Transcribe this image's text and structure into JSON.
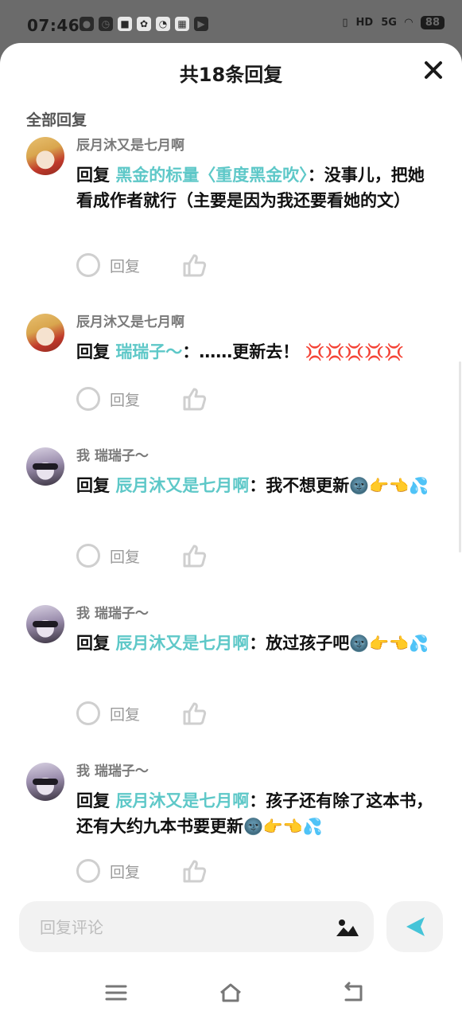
{
  "status_bar": {
    "time": "07:46",
    "left_icons": [
      "wechat-icon",
      "compass-icon",
      "app-icon",
      "baidu-icon",
      "qq-browser-icon",
      "game-icon",
      "media-icon"
    ],
    "right_icons": [
      "vibrate-icon",
      "hd-icon",
      "signal-5g-icon",
      "wifi-icon"
    ],
    "network": "5G",
    "hd": "HD",
    "battery": "88"
  },
  "sheet": {
    "title": "共18条回复",
    "section_label": "全部回复"
  },
  "comments": [
    {
      "user": "辰月沐又是七月啊",
      "reply_prefix": "回复",
      "mention": "黑金的标量〈重度黑金吹〉",
      "text": "：没事儿，把她看成作者就行（主要是因为我还要看她的文）",
      "avatar": "avatar-girl-red",
      "reply_label": "回复"
    },
    {
      "user": "辰月沐又是七月啊",
      "reply_prefix": "回复",
      "mention": "瑞瑞子～",
      "text": "：……更新去！",
      "emoji": "💢💢💢💢💢",
      "avatar": "avatar-girl-red",
      "reply_label": "回复"
    },
    {
      "user": "我 瑞瑞子～",
      "reply_prefix": "回复",
      "mention": "辰月沐又是七月啊",
      "text": "：我不想更新",
      "emoji": "🌚👉👈💦",
      "avatar": "avatar-girl-blindfold",
      "reply_label": "回复"
    },
    {
      "user": "我 瑞瑞子～",
      "reply_prefix": "回复",
      "mention": "辰月沐又是七月啊",
      "text": "：放过孩子吧",
      "emoji": "🌚👉👈💦",
      "avatar": "avatar-girl-blindfold",
      "reply_label": "回复"
    },
    {
      "user": "我 瑞瑞子～",
      "reply_prefix": "回复",
      "mention": "辰月沐又是七月啊",
      "text": "：孩子还有除了这本书，还有大约九本书要更新",
      "emoji": "🌚👉👈💦",
      "avatar": "avatar-girl-blindfold",
      "reply_label": "回复"
    }
  ],
  "input": {
    "placeholder": "回复评论"
  },
  "colors": {
    "mention": "#5ec8c8",
    "send": "#45c4d8",
    "background": "#ffffff",
    "input_bg": "#f2f2f2"
  }
}
